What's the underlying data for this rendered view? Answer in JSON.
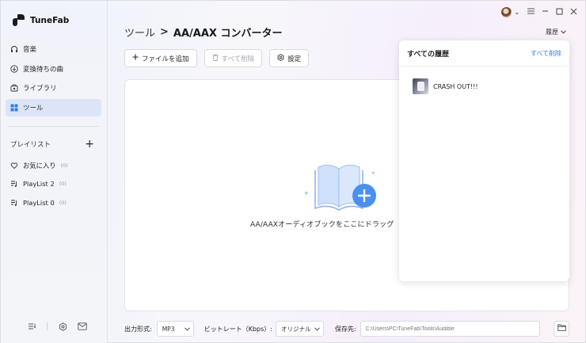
{
  "app": {
    "name": "TuneFab"
  },
  "sidebar": {
    "items": [
      {
        "label": "音楽",
        "icon": "headphones-icon"
      },
      {
        "label": "変換待ちの曲",
        "icon": "download-icon"
      },
      {
        "label": "ライブラリ",
        "icon": "library-icon"
      },
      {
        "label": "ツール",
        "icon": "grid-icon",
        "active": true
      }
    ],
    "playlist_header": "プレイリスト",
    "playlists": [
      {
        "label": "お気に入り",
        "count": "(0)",
        "icon": "heart-icon"
      },
      {
        "label": "PlayList 2",
        "count": "(0)",
        "icon": "playlist-icon"
      },
      {
        "label": "PlayList 0",
        "count": "(0)",
        "icon": "playlist-icon"
      }
    ]
  },
  "header": {
    "breadcrumb_parent": "ツール",
    "breadcrumb_sep": ">",
    "breadcrumb_current": "AA/AAX コンバーター",
    "history_label": "履歴"
  },
  "toolbar": {
    "add_file": "ファイルを追加",
    "delete_all": "すべて削除",
    "settings": "設定"
  },
  "dropzone": {
    "text": "AA/AAXオーディオブックをここにドラッグ"
  },
  "footer": {
    "format_label": "出力形式:",
    "format_value": "MP3",
    "bitrate_label": "ビットレート（Kbps）:",
    "bitrate_value": "オリジナル",
    "save_label": "保存先:",
    "save_path": "C:\\Users\\PC\\TuneFab\\Tools\\Audible"
  },
  "history_panel": {
    "title": "すべての履歴",
    "clear_all": "すべて削除",
    "items": [
      {
        "name": "CRASH OUT!!!"
      }
    ]
  },
  "colors": {
    "accent": "#2f7ee8",
    "active_nav": "#dce5f8",
    "illustration_blue": "#4a90f0"
  }
}
